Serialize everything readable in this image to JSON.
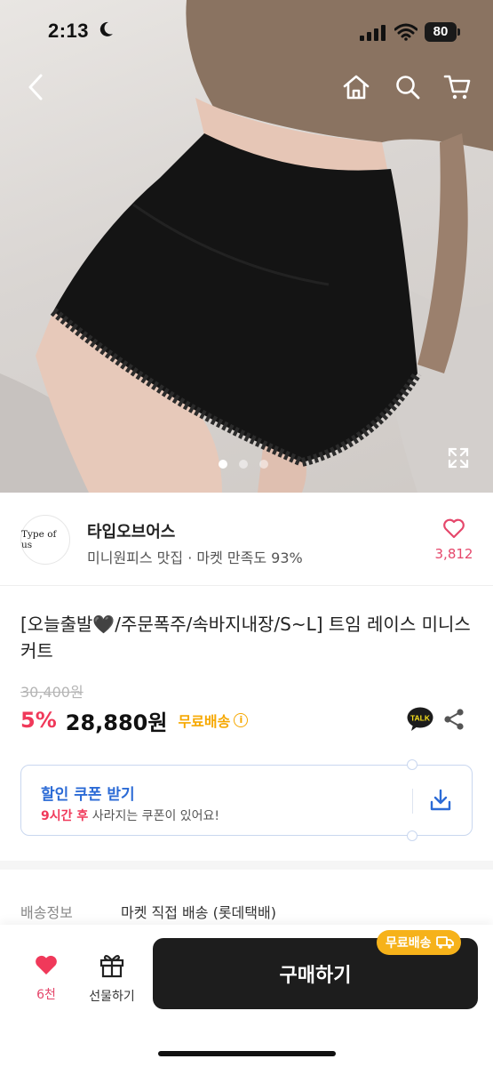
{
  "status_bar": {
    "time": "2:13",
    "battery": "80"
  },
  "hero": {
    "total_images": 3,
    "active_index": 0
  },
  "seller": {
    "logo_text": "Type of us",
    "name": "타입오브어스",
    "meta": "미니원피스 맛집 · 마켓 만족도 93%",
    "like_count": "3,812"
  },
  "product": {
    "title": "[오늘출발🖤/주문폭주/속바지내장/S~L] 트임 레이스 미니스커트",
    "original_price": "30,400원",
    "discount": "5%",
    "sale_price": "28,880원",
    "free_shipping": "무료배송"
  },
  "coupon": {
    "title": "할인 쿠폰 받기",
    "desc_highlight": "9시간 후",
    "desc_rest": " 사라지는 쿠폰이 있어요!"
  },
  "shipping": {
    "label": "배송정보",
    "value": "마켓 직접 배송 (롯데택배)"
  },
  "bottom_bar": {
    "wish_count": "6천",
    "gift_label": "선물하기",
    "buy_label": "구매하기",
    "ship_badge": "무료배송"
  },
  "icons": {
    "back": "chevron-left-icon",
    "home": "home-icon",
    "search": "search-icon",
    "cart": "cart-icon",
    "expand": "expand-icon",
    "heart": "heart-icon",
    "talk": "kakao-talk-icon",
    "share": "share-icon",
    "download": "download-icon",
    "gift": "gift-icon",
    "truck": "truck-icon"
  },
  "colors": {
    "accent_pink": "#f0395a",
    "brand_yellow": "#f6a800",
    "coupon_blue": "#2c6bd6",
    "buy_button": "#1d1d1d"
  }
}
